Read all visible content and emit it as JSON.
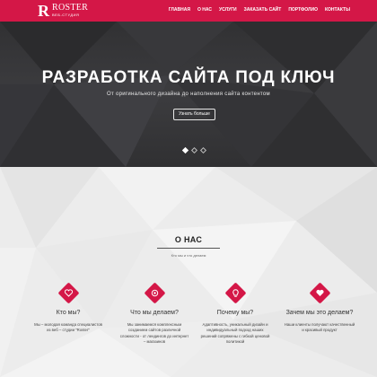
{
  "header": {
    "logo_mark": "R",
    "logo_name": "ROSTER",
    "logo_sub": "ВЕБ-СТУДИЯ",
    "nav": [
      "ГЛАВНАЯ",
      "О НАС",
      "УСЛУГИ",
      "ЗАКАЗАТЬ САЙТ",
      "ПОРТФОЛИО",
      "КОНТАКТЫ"
    ]
  },
  "hero": {
    "title": "РАЗРАБОТКА САЙТА ПОД КЛЮЧ",
    "subtitle": "От оригинального дизайна до наполнения сайта контентом",
    "button": "Узнать больше",
    "slides": 3,
    "active_slide": 1
  },
  "about": {
    "title": "О НАС",
    "subtitle": "Кто мы и что делаем",
    "features": [
      {
        "icon": "heart-icon",
        "title": "Кто мы?",
        "desc": "Мы – молодая команда специалистов из веб – студии \"Roster\""
      },
      {
        "icon": "target-icon",
        "title": "Что мы делаем?",
        "desc": "Мы занимаемся комплексным созданием сайтов различной сложности - от лендингов до интернет – магазинов"
      },
      {
        "icon": "idea-icon",
        "title": "Почему мы?",
        "desc": "Адаптивность, уникальный дизайн и индивидуальный подход наших решений сопряжены с гибкой ценовой политикой"
      },
      {
        "icon": "heart-icon",
        "title": "Зачем мы это делаем?",
        "desc": "Наши клиенты получают качественный и красивый продукт"
      }
    ]
  },
  "colors": {
    "accent": "#d41747",
    "hero_bg": "#353537",
    "section_bg": "#ececec"
  }
}
